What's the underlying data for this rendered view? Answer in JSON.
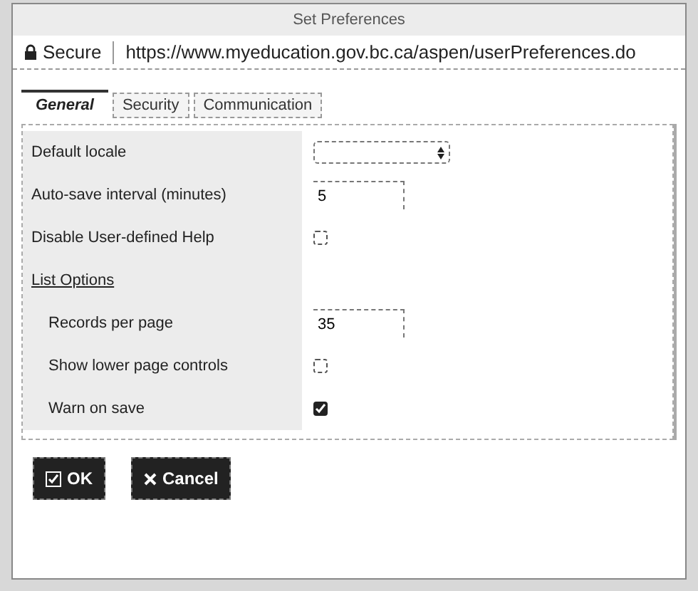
{
  "window": {
    "title": "Set Preferences"
  },
  "address_bar": {
    "security": "Secure",
    "url": "https://www.myeducation.gov.bc.ca/aspen/userPreferences.do"
  },
  "tabs": [
    {
      "label": "General",
      "selected": true
    },
    {
      "label": "Security",
      "selected": false
    },
    {
      "label": "Communication",
      "selected": false
    }
  ],
  "fields": [
    {
      "kind": "select",
      "label": "Default locale"
    },
    {
      "kind": "text",
      "label": "Auto-save interval (minutes)",
      "value": "5"
    },
    {
      "kind": "checkbox",
      "label": "Disable User-defined Help",
      "checked": false
    },
    {
      "kind": "heading",
      "label": "List Options",
      "children": [
        {
          "kind": "text",
          "label": "Records per page",
          "value": "35"
        },
        {
          "kind": "checkbox",
          "label": "Show lower page controls",
          "checked": false
        },
        {
          "kind": "checkbox",
          "label": "Warn on save",
          "checked": true
        }
      ]
    }
  ],
  "buttons": [
    {
      "kind": "ok",
      "label": "OK"
    },
    {
      "kind": "cancel",
      "label": "Cancel"
    }
  ]
}
